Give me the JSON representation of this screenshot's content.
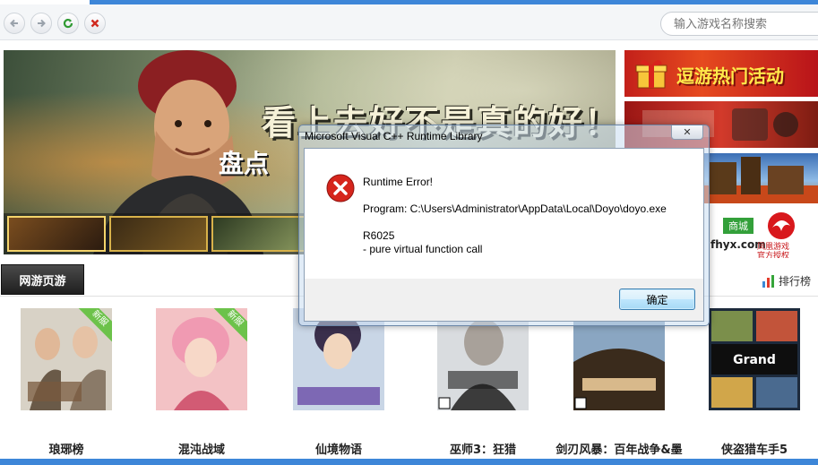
{
  "search": {
    "placeholder": "输入游戏名称搜索"
  },
  "banner": {
    "headline": "看上去好不是真的好！",
    "subheadline": "盘点"
  },
  "side_ads": {
    "ad1": "逗游热门活动",
    "ad4_badge": "商城",
    "ad4_site": "fhyx.com",
    "ad4_logo_label": "凤凰游戏\n官方授权"
  },
  "section": {
    "tab_label": "网游页游",
    "ranking_label": "排行榜"
  },
  "games": [
    {
      "name": "琅琊榜",
      "new_badge": "新服",
      "colors": [
        "#d8d2c6",
        "#7a5a3d"
      ]
    },
    {
      "name": "混沌战域",
      "new_badge": "新服",
      "colors": [
        "#f3c2c5",
        "#d25b74"
      ]
    },
    {
      "name": "仙境物语",
      "new_badge": "",
      "colors": [
        "#c9d6e6",
        "#4a3a6c"
      ]
    },
    {
      "name": "巫师3：狂猎",
      "new_badge": "",
      "colors": [
        "#d9dcdf",
        "#3b3b3b"
      ]
    },
    {
      "name": "剑刃风暴：百年战争&amp;墨",
      "new_badge": "",
      "colors": [
        "#d8b98b",
        "#3a2b1c"
      ]
    },
    {
      "name": "侠盗猎车手5",
      "new_badge": "",
      "colors": [
        "#7b8f4b",
        "#1d2a3c"
      ]
    }
  ],
  "dialog": {
    "title": "Microsoft Visual C++ Runtime Library",
    "close_label": "✕",
    "line1": "Runtime Error!",
    "line2": "Program: C:\\Users\\Administrator\\AppData\\Local\\Doyo\\doyo.exe",
    "line3": "R6025",
    "line4": "- pure virtual function call",
    "ok_label": "确定"
  },
  "colors": {
    "accent_blue": "#3d86d8",
    "error_red": "#d6251c"
  }
}
